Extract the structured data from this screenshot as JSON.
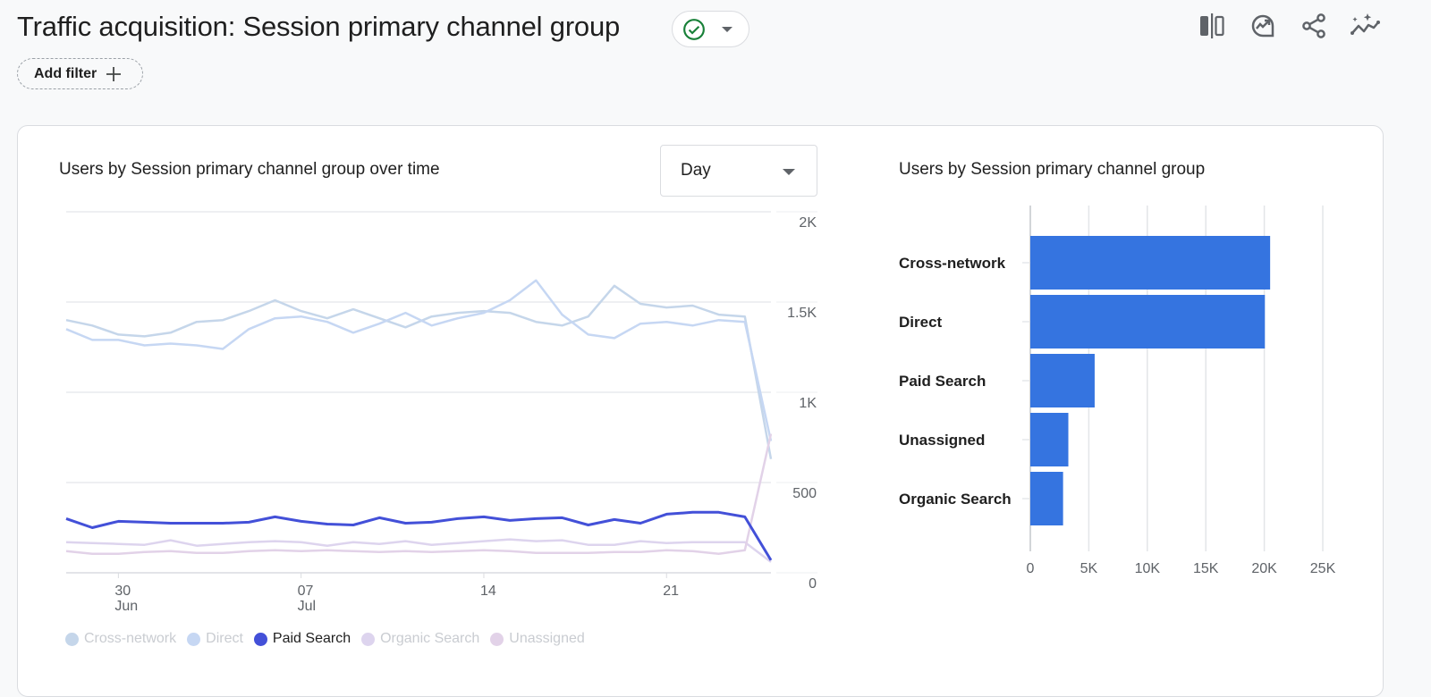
{
  "header": {
    "title": "Traffic acquisition: Session primary channel group",
    "status_icon": "check-circle-icon",
    "status_color": "#188038",
    "add_filter_label": "Add filter",
    "toolbar_icons": [
      "compare-icon",
      "insights-icon",
      "share-icon",
      "sparkle-trend-icon"
    ]
  },
  "line_card": {
    "title": "Users by Session primary channel group over time",
    "granularity": {
      "selected": "Day"
    }
  },
  "bar_card": {
    "title": "Users by Session primary channel group"
  },
  "chart_data": [
    {
      "type": "line",
      "title": "Users by Session primary channel group over time",
      "x": [
        "Jun 28",
        "Jun 29",
        "Jun 30",
        "Jul 01",
        "Jul 02",
        "Jul 03",
        "Jul 04",
        "Jul 05",
        "Jul 06",
        "Jul 07",
        "Jul 08",
        "Jul 09",
        "Jul 10",
        "Jul 11",
        "Jul 12",
        "Jul 13",
        "Jul 14",
        "Jul 15",
        "Jul 16",
        "Jul 17",
        "Jul 18",
        "Jul 19",
        "Jul 20",
        "Jul 21",
        "Jul 22",
        "Jul 23",
        "Jul 24",
        "Jul 25"
      ],
      "x_tick_labels": [
        {
          "day": "30",
          "month": "Jun",
          "index": 2
        },
        {
          "day": "07",
          "month": "Jul",
          "index": 9
        },
        {
          "day": "14",
          "month": "",
          "index": 16
        },
        {
          "day": "21",
          "month": "",
          "index": 23
        }
      ],
      "y_ticks": [
        "0",
        "500",
        "1K",
        "1.5K",
        "2K"
      ],
      "ylim": [
        0,
        2000
      ],
      "y_axis_side": "right",
      "grid": true,
      "legend_position": "bottom-left",
      "series": [
        {
          "name": "Cross-network",
          "color": "#c5d6ea",
          "highlighted": false,
          "values": [
            1400,
            1370,
            1320,
            1310,
            1330,
            1390,
            1400,
            1450,
            1510,
            1450,
            1410,
            1460,
            1410,
            1360,
            1420,
            1440,
            1450,
            1440,
            1390,
            1370,
            1420,
            1590,
            1490,
            1470,
            1480,
            1430,
            1420,
            630
          ]
        },
        {
          "name": "Direct",
          "color": "#c6d7f3",
          "highlighted": false,
          "values": [
            1350,
            1290,
            1290,
            1260,
            1270,
            1260,
            1240,
            1350,
            1410,
            1420,
            1390,
            1330,
            1380,
            1440,
            1370,
            1410,
            1440,
            1510,
            1620,
            1430,
            1320,
            1300,
            1380,
            1390,
            1370,
            1400,
            1390,
            730
          ]
        },
        {
          "name": "Paid Search",
          "color": "#4350d8",
          "highlighted": true,
          "values": [
            300,
            250,
            285,
            280,
            275,
            275,
            275,
            280,
            310,
            285,
            270,
            265,
            305,
            275,
            280,
            300,
            310,
            290,
            300,
            305,
            265,
            295,
            275,
            325,
            335,
            335,
            310,
            70
          ]
        },
        {
          "name": "Organic Search",
          "color": "#ddd4ee",
          "highlighted": false,
          "values": [
            170,
            165,
            160,
            155,
            180,
            150,
            160,
            170,
            175,
            170,
            150,
            170,
            160,
            175,
            155,
            165,
            175,
            185,
            175,
            180,
            155,
            155,
            175,
            165,
            170,
            170,
            170,
            60
          ]
        },
        {
          "name": "Unassigned",
          "color": "#e2d2e8",
          "highlighted": false,
          "values": [
            120,
            105,
            105,
            115,
            120,
            110,
            110,
            120,
            125,
            120,
            125,
            120,
            115,
            120,
            115,
            120,
            125,
            120,
            110,
            110,
            110,
            115,
            115,
            125,
            120,
            105,
            125,
            770
          ]
        }
      ]
    },
    {
      "type": "bar",
      "orientation": "horizontal",
      "title": "Users by Session primary channel group",
      "categories": [
        "Cross-network",
        "Direct",
        "Paid Search",
        "Unassigned",
        "Organic Search"
      ],
      "values": [
        20500,
        20050,
        5500,
        3250,
        2800
      ],
      "x_ticks": [
        "0",
        "5K",
        "10K",
        "15K",
        "20K",
        "25K"
      ],
      "xlim": [
        0,
        25000
      ],
      "grid": true,
      "bar_color": "#3574e0"
    }
  ]
}
